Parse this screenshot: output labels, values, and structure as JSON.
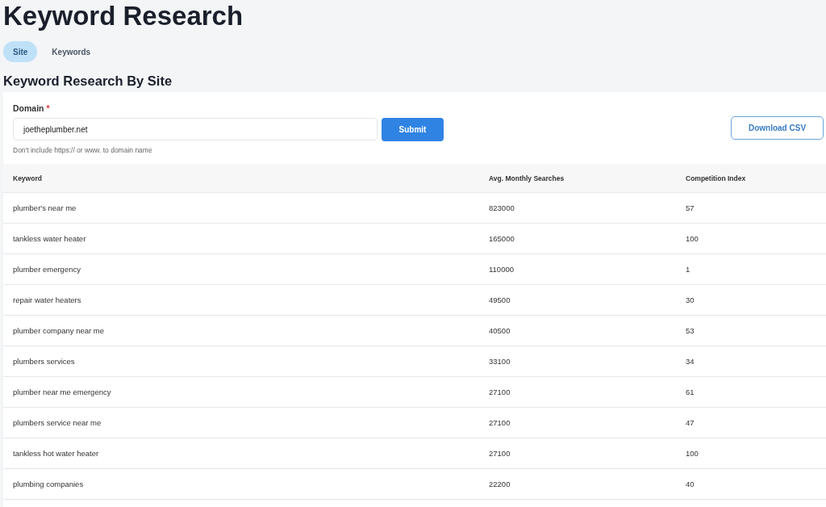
{
  "title": "Keyword Research",
  "tabs": [
    {
      "label": "Site",
      "selected": true
    },
    {
      "label": "Keywords",
      "selected": false
    }
  ],
  "section_title": "Keyword Research By Site",
  "form": {
    "label": "Domain",
    "required_mark": "*",
    "value": "joetheplumber.net",
    "hint": "Don't include https:// or www. to domain name",
    "submit": "Submit",
    "download": "Download CSV"
  },
  "table": {
    "columns": [
      "Keyword",
      "Avg. Monthly Searches",
      "Competition Index"
    ],
    "rows": [
      [
        "plumber's near me",
        "823000",
        "57"
      ],
      [
        "tankless water heater",
        "165000",
        "100"
      ],
      [
        "plumber emergency",
        "110000",
        "1"
      ],
      [
        "repair water heaters",
        "49500",
        "30"
      ],
      [
        "plumber company near me",
        "40500",
        "53"
      ],
      [
        "plumbers services",
        "33100",
        "34"
      ],
      [
        "plumber near me emergency",
        "27100",
        "61"
      ],
      [
        "plumbers service near me",
        "27100",
        "47"
      ],
      [
        "tankless hot water heater",
        "27100",
        "100"
      ],
      [
        "plumbing companies",
        "22200",
        "40"
      ]
    ]
  }
}
